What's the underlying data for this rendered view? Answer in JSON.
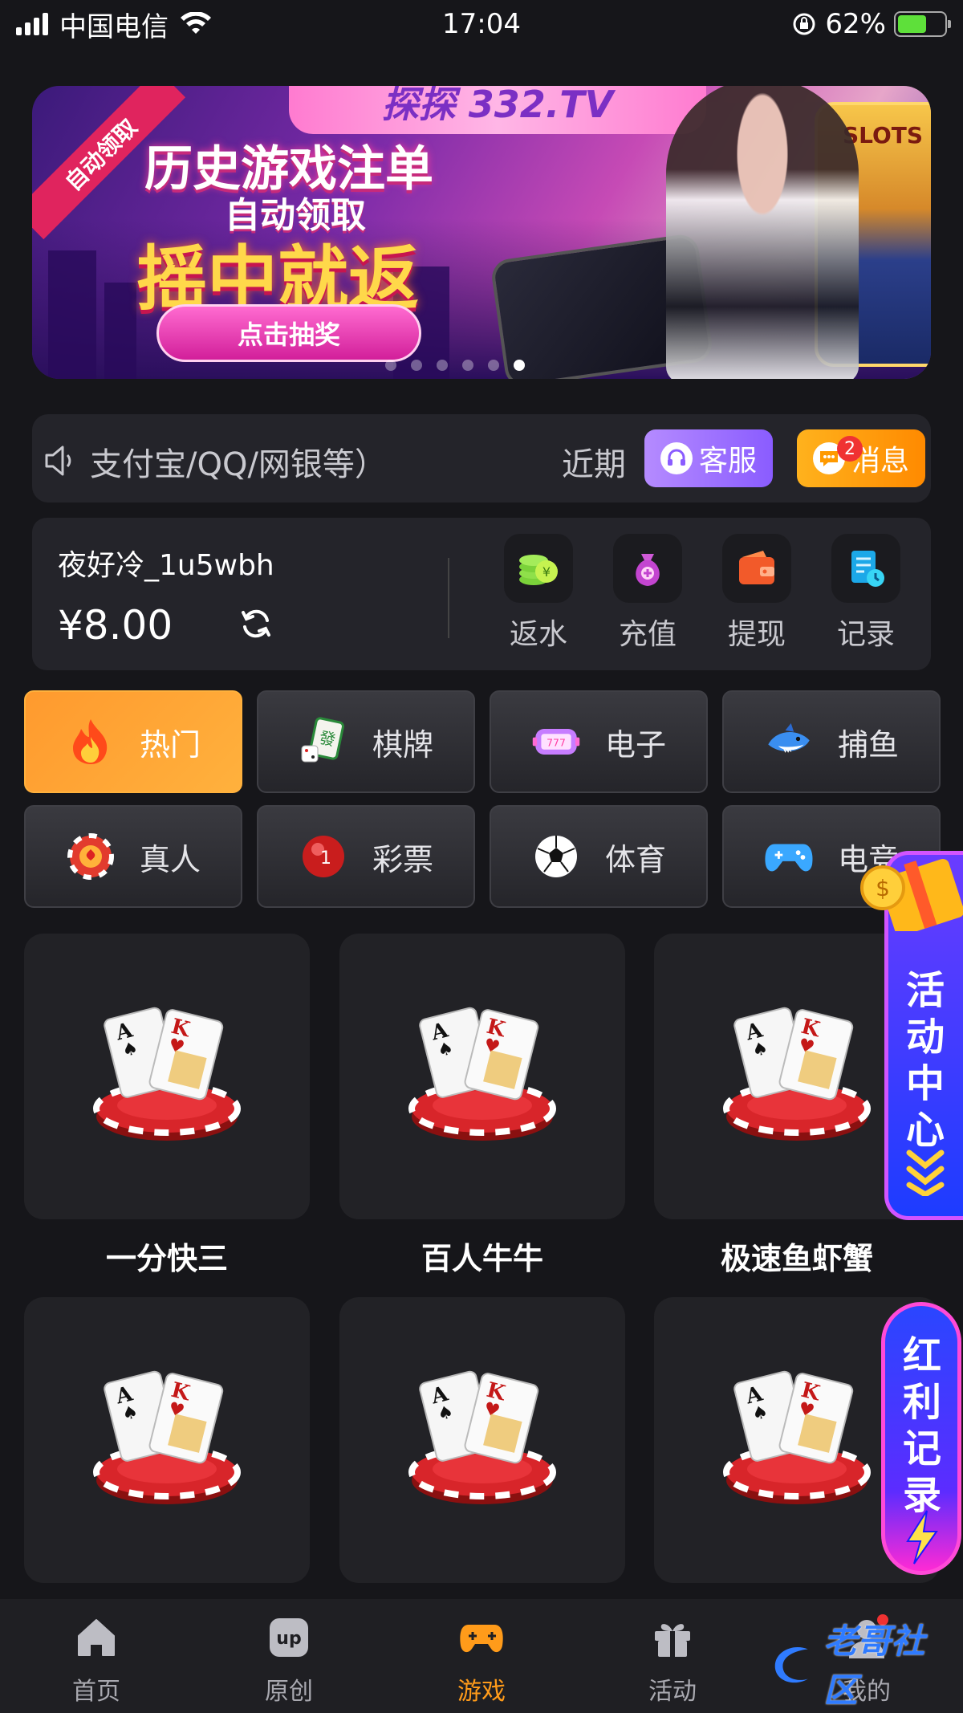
{
  "status": {
    "carrier": "中国电信",
    "time": "17:04",
    "battery": "62%"
  },
  "banner": {
    "brand": "探探 332.TV",
    "ribbon": "自动领取",
    "line1": "历史游戏注单",
    "line2": "自动领取",
    "line3": "摇中就返",
    "cta": "点击抽奖",
    "slot_title": "SLOTS",
    "slide_count": 6,
    "active_slide": 5
  },
  "notice": {
    "text": "支付宝/QQ/网银等）",
    "recent": "近期",
    "service_label": "客服",
    "message_label": "消息",
    "message_badge": "2"
  },
  "wallet": {
    "username": "夜好冷_1u5wbh",
    "balance": "¥8.00",
    "actions": [
      {
        "label": "返水",
        "icon": "coins-icon"
      },
      {
        "label": "充值",
        "icon": "money-bag-icon"
      },
      {
        "label": "提现",
        "icon": "wallet-icon"
      },
      {
        "label": "记录",
        "icon": "record-icon"
      }
    ]
  },
  "categories": [
    {
      "label": "热门",
      "icon": "flame-icon",
      "active": true
    },
    {
      "label": "棋牌",
      "icon": "mahjong-icon",
      "active": false
    },
    {
      "label": "电子",
      "icon": "slot-machine-icon",
      "active": false
    },
    {
      "label": "捕鱼",
      "icon": "shark-icon",
      "active": false
    },
    {
      "label": "真人",
      "icon": "chip-icon",
      "active": false
    },
    {
      "label": "彩票",
      "icon": "lottery-ball-icon",
      "active": false
    },
    {
      "label": "体育",
      "icon": "soccer-ball-icon",
      "active": false
    },
    {
      "label": "电竞",
      "icon": "gamepad-icon",
      "active": false
    }
  ],
  "games": [
    {
      "name": "一分快三"
    },
    {
      "name": "百人牛牛"
    },
    {
      "name": "极速鱼虾蟹"
    },
    {
      "name": ""
    },
    {
      "name": ""
    },
    {
      "name": ""
    }
  ],
  "floating": {
    "activity_center": "活动中心",
    "bonus_record": "红利记录"
  },
  "tabs": [
    {
      "label": "首页",
      "icon": "home-icon",
      "active": false
    },
    {
      "label": "原创",
      "icon": "up-icon",
      "active": false
    },
    {
      "label": "游戏",
      "icon": "game-controller-icon",
      "active": true
    },
    {
      "label": "活动",
      "icon": "gift-icon",
      "active": false
    },
    {
      "label": "我的",
      "icon": "user-icon",
      "active": false
    }
  ],
  "watermark": "老哥社区",
  "colors": {
    "background": "#16161a",
    "card": "#24242a",
    "accent_orange": "#ff9b1a",
    "service_purple": "#8a5cff",
    "message_orange": "#ff8a00",
    "badge_red": "#f03232"
  }
}
